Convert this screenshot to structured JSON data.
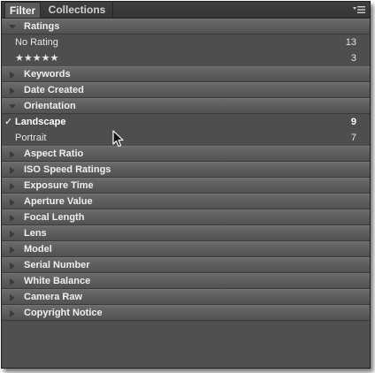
{
  "tabs": [
    {
      "label": "Filter",
      "active": true
    },
    {
      "label": "Collections",
      "active": false
    }
  ],
  "panel_menu_icon": "panel-menu-icon",
  "sections": [
    {
      "label": "Ratings",
      "expanded": true,
      "rows": [
        {
          "label": "No Rating",
          "count": "13",
          "selected": false
        },
        {
          "label": "★★★★★",
          "count": "3",
          "selected": false,
          "stars": true
        }
      ]
    },
    {
      "label": "Keywords",
      "expanded": false
    },
    {
      "label": "Date Created",
      "expanded": false
    },
    {
      "label": "Orientation",
      "expanded": true,
      "rows": [
        {
          "label": "Landscape",
          "count": "9",
          "selected": true
        },
        {
          "label": "Portrait",
          "count": "7",
          "selected": false
        }
      ]
    },
    {
      "label": "Aspect Ratio",
      "expanded": false
    },
    {
      "label": "ISO Speed Ratings",
      "expanded": false
    },
    {
      "label": "Exposure Time",
      "expanded": false
    },
    {
      "label": "Aperture Value",
      "expanded": false
    },
    {
      "label": "Focal Length",
      "expanded": false
    },
    {
      "label": "Lens",
      "expanded": false
    },
    {
      "label": "Model",
      "expanded": false
    },
    {
      "label": "Serial Number",
      "expanded": false
    },
    {
      "label": "White Balance",
      "expanded": false
    },
    {
      "label": "Camera Raw",
      "expanded": false
    },
    {
      "label": "Copyright Notice",
      "expanded": false
    }
  ],
  "check_glyph": "✓",
  "colors": {
    "panel_bg": "#505050",
    "header_bg": "#5e5e5e",
    "text": "#efefef"
  }
}
